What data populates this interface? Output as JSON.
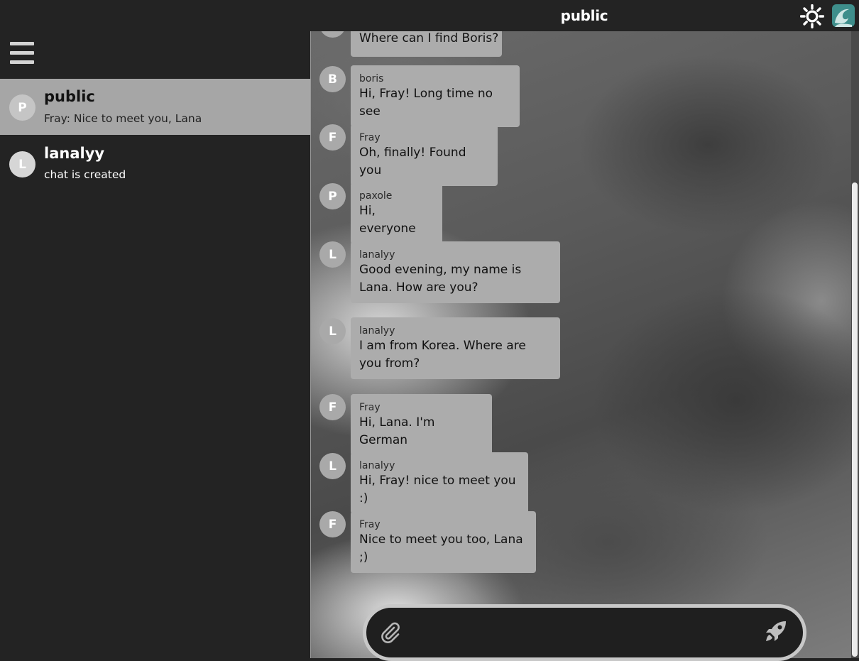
{
  "header": {
    "title": "public"
  },
  "icons": {
    "theme_toggle": "sun-icon",
    "logo": "wave-logo-icon",
    "menu": "hamburger-menu-icon",
    "attach": "paperclip-icon",
    "send": "rocket-icon"
  },
  "colors": {
    "background": "#232323",
    "active_chat": "#a6a6a6",
    "bubble": "#acacac",
    "logo_accent": "#3e8e8b"
  },
  "sidebar": {
    "chats": [
      {
        "avatar": "P",
        "name": "public",
        "last": "Fray: Nice to meet you, Lana",
        "active": true
      },
      {
        "avatar": "L",
        "name": "lanalyy",
        "last": "chat is created",
        "active": false
      }
    ]
  },
  "messages": [
    {
      "avatar": "",
      "sender": "",
      "text": "Where can I find Boris?"
    },
    {
      "avatar": "B",
      "sender": "boris",
      "text": "Hi, Fray! Long time no see"
    },
    {
      "avatar": "F",
      "sender": "Fray",
      "text": "Oh, finally! Found you"
    },
    {
      "avatar": "P",
      "sender": "paxole",
      "text": "Hi, everyone"
    },
    {
      "avatar": "L",
      "sender": "lanalyy",
      "text": "Good evening, my name is Lana. How are you?"
    },
    {
      "avatar": "L",
      "sender": "lanalyy",
      "text": "I am from Korea. Where are you from?"
    },
    {
      "avatar": "F",
      "sender": "Fray",
      "text": "Hi, Lana. I'm German"
    },
    {
      "avatar": "L",
      "sender": "lanalyy",
      "text": "Hi, Fray! nice to meet you :)"
    },
    {
      "avatar": "F",
      "sender": "Fray",
      "text": "Nice to meet you too, Lana ;)"
    }
  ],
  "composer": {
    "placeholder": ""
  }
}
